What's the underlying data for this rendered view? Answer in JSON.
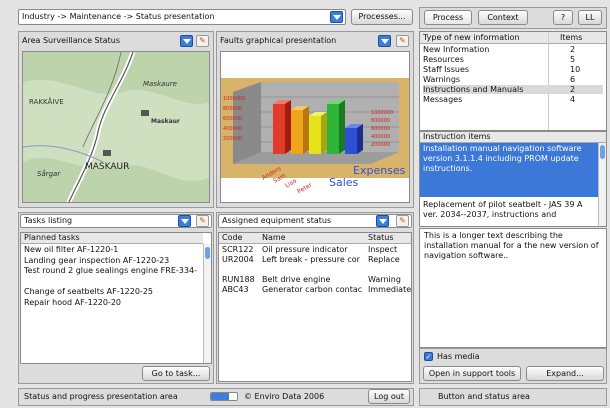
{
  "colors": {
    "accent": "#3d7fd8",
    "selection": "#3c78d8",
    "map_green": "#cfe0c1"
  },
  "top": {
    "breadcrumb": "Industry -> Maintenance -> Status presentation",
    "processes_label": "Processes..."
  },
  "right_tabs": {
    "process": "Process",
    "context": "Context",
    "help": "?",
    "extra": "LL"
  },
  "area_panel": {
    "title": "Area Surveillance Status",
    "map_labels": [
      "Maskaure",
      "RAKKÅIVE",
      "Maskaur",
      "MASKAUR",
      "Sårgar"
    ]
  },
  "faults_panel": {
    "title": "Faults graphical presentation",
    "chart_labels": {
      "expenses": "Expenses",
      "sales": "Sales",
      "persons": [
        "Anders",
        "Sam",
        "Lisa",
        "Peter"
      ]
    }
  },
  "info_types": {
    "col_type": "Type of new information",
    "col_items": "Items",
    "rows": [
      {
        "type": "New Information",
        "items": "2"
      },
      {
        "type": "Resources",
        "items": "5"
      },
      {
        "type": "Staff Issues",
        "items": "10"
      },
      {
        "type": "Warnings",
        "items": "6"
      },
      {
        "type": "Instructions and Manuals",
        "items": "2"
      },
      {
        "type": "Messages",
        "items": "4"
      }
    ]
  },
  "instruction_items": {
    "title": "Instruction items",
    "selected": "Installation manual navigation software version 3.1.1.4 including PROM update instructions.",
    "second": "Replacement of pilot seatbelt - JAS 39 A ver. 2034--2037, instructions and",
    "detail": "This is a longer text describing the installation manual for a the new version of navigation software..",
    "has_media": "Has media",
    "open_support": "Open in support tools",
    "expand": "Expand..."
  },
  "tasks": {
    "title": "Tasks listing",
    "header": "Planned tasks",
    "items": [
      "New oil filter AF-1220-1",
      "Landing gear inspection AF-1220-23",
      "Test round 2 glue sealings engine FRE-334-",
      "",
      "Change of seatbelts AF-1220-25",
      "Repair hood AF-1220-20"
    ],
    "goto_label": "Go to task..."
  },
  "equipment": {
    "title": "Assigned equipment status",
    "columns": [
      "Code",
      "Name",
      "Status"
    ],
    "rows": [
      {
        "code": "SCR122",
        "name": "Oil pressure indicator",
        "status": "Inspect"
      },
      {
        "code": "UR2004",
        "name": "Left break - pressure cor",
        "status": "Replace"
      },
      {
        "code": "",
        "name": "",
        "status": ""
      },
      {
        "code": "RUN188",
        "name": "Belt drive engine",
        "status": "Warning"
      },
      {
        "code": "ABC43",
        "name": "Generator carbon contac",
        "status": "Immediate"
      }
    ]
  },
  "bottom": {
    "status_area": "Status and progress presentation area",
    "copyright": "© Enviro Data 2006",
    "logout": "Log out",
    "button_area": "Button and status area"
  }
}
